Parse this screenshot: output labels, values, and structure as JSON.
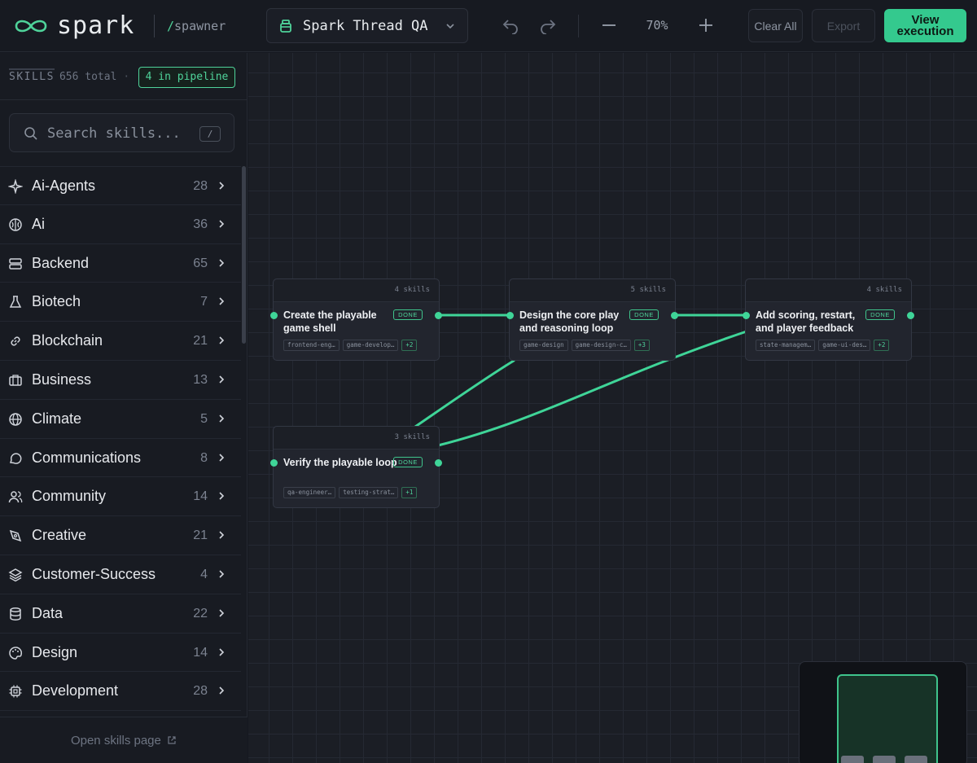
{
  "header": {
    "brand": "spark",
    "sub_slash": "/",
    "sub": "spawner",
    "project_name": "Spark Thread QA",
    "zoom": "70%",
    "clear_label": "Clear All",
    "export_label": "Export",
    "view_label": "View execution"
  },
  "sidebar": {
    "skills_label": "SKILLS",
    "total": "656 total",
    "dot": "·",
    "pipeline_badge": "4 in pipeline",
    "search_placeholder": "Search skills...",
    "search_shortcut": "/",
    "categories": [
      {
        "label": "Ai-Agents",
        "count": "28",
        "icon": "sparkle-icon"
      },
      {
        "label": "Ai",
        "count": "36",
        "icon": "brain-icon"
      },
      {
        "label": "Backend",
        "count": "65",
        "icon": "server-icon"
      },
      {
        "label": "Biotech",
        "count": "7",
        "icon": "flask-icon"
      },
      {
        "label": "Blockchain",
        "count": "21",
        "icon": "link-icon"
      },
      {
        "label": "Business",
        "count": "13",
        "icon": "briefcase-icon"
      },
      {
        "label": "Climate",
        "count": "5",
        "icon": "globe-icon"
      },
      {
        "label": "Communications",
        "count": "8",
        "icon": "chat-icon"
      },
      {
        "label": "Community",
        "count": "14",
        "icon": "users-icon"
      },
      {
        "label": "Creative",
        "count": "21",
        "icon": "pen-tool-icon"
      },
      {
        "label": "Customer-Success",
        "count": "4",
        "icon": "layers-icon"
      },
      {
        "label": "Data",
        "count": "22",
        "icon": "database-icon"
      },
      {
        "label": "Design",
        "count": "14",
        "icon": "palette-icon"
      },
      {
        "label": "Development",
        "count": "28",
        "icon": "chip-icon"
      }
    ],
    "footer_link": "Open skills page"
  },
  "canvas": {
    "nodes": [
      {
        "title": "Create the playable game shell",
        "skills": "4 skills",
        "status": "DONE",
        "tags": [
          "frontend-eng…",
          "game-develop…"
        ],
        "more": "+2"
      },
      {
        "title": "Design the core play and reasoning loop",
        "skills": "5 skills",
        "status": "DONE",
        "tags": [
          "game-design",
          "game-design-c…"
        ],
        "more": "+3"
      },
      {
        "title": "Add scoring, restart, and player feedback",
        "skills": "4 skills",
        "status": "DONE",
        "tags": [
          "state-managem…",
          "game-ui-des…"
        ],
        "more": "+2"
      },
      {
        "title": "Verify the playable loop",
        "skills": "3 skills",
        "status": "DONE",
        "tags": [
          "qa-engineer…",
          "testing-strat…"
        ],
        "more": "+1"
      }
    ]
  },
  "colors": {
    "accent": "#34c98e",
    "background": "#151820"
  }
}
